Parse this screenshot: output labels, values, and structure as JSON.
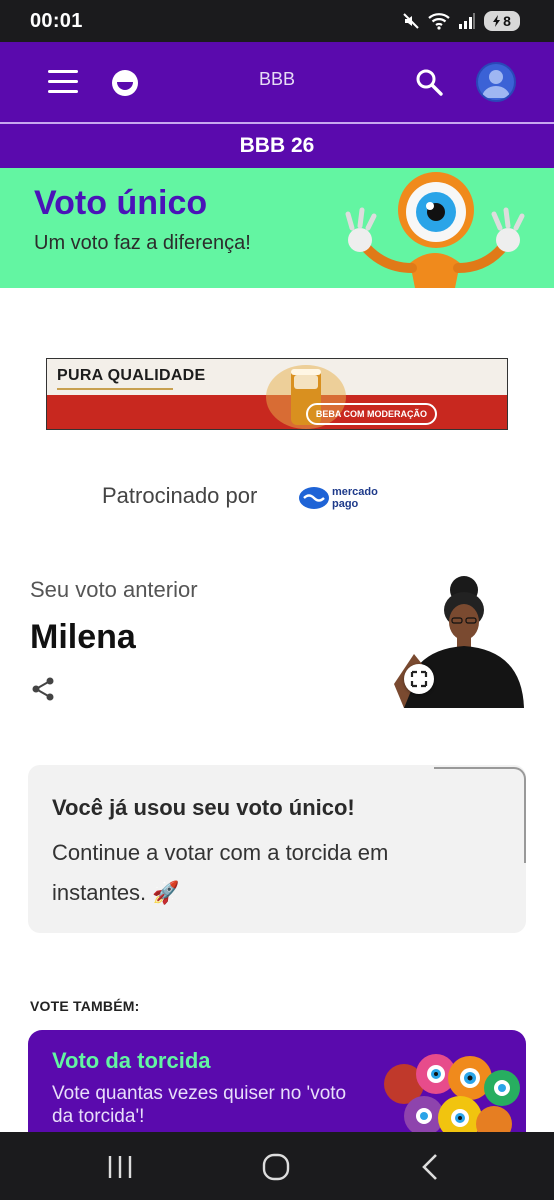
{
  "status": {
    "time": "00:01",
    "battery": "8"
  },
  "appbar": {
    "title": "BBB"
  },
  "subbar": {
    "label": "BBB 26"
  },
  "hero": {
    "title": "Voto único",
    "subtitle": "Um voto faz a diferença!"
  },
  "ad": {
    "headline": "PURA QUALIDADE",
    "warning": "BEBA COM MODERAÇÃO"
  },
  "sponsor": {
    "label": "Patrocinado por",
    "brand_line1": "mercado",
    "brand_line2": "pago"
  },
  "previous_vote": {
    "label": "Seu voto anterior",
    "name": "Milena"
  },
  "notice": {
    "title": "Você já usou seu voto único!",
    "body": "Continue a votar com a torcida em instantes. 🚀"
  },
  "vote_also": {
    "label": "VOTE TAMBÉM:"
  },
  "torcida_card": {
    "title": "Voto da torcida",
    "description": "Vote quantas vezes quiser no 'voto da torcida'!"
  },
  "colors": {
    "brand_purple": "#5a0aad",
    "hero_green": "#63f5a2",
    "accent_text": "#4a13b8"
  }
}
